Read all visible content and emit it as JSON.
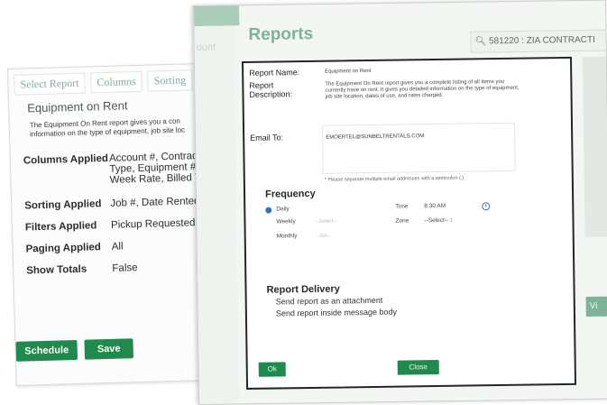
{
  "left_panel": {
    "tabs": [
      "Select Report",
      "Columns",
      "Sorting"
    ],
    "title": "Equipment on Rent",
    "description": [
      "The Equipment On Rent report gives you a con",
      "information on the type of equipment, job site loc"
    ],
    "rows": [
      {
        "key": "Columns Applied",
        "value": [
          "Account #, Contract",
          "Type, Equipment #,",
          "Week Rate, Billed T"
        ]
      },
      {
        "key": "Sorting Applied",
        "value": [
          "Job #, Date Rented,"
        ]
      },
      {
        "key": "Filters Applied",
        "value": [
          "Pickup Requested ="
        ]
      },
      {
        "key": "Paging Applied",
        "value": [
          "All"
        ]
      },
      {
        "key": "Show Totals",
        "value": [
          "False"
        ]
      }
    ],
    "schedule_label": "Schedule",
    "save_label": "Save"
  },
  "right_panel": {
    "sidebar_ghost": "ount",
    "title": "Reports",
    "search_text": "581220 : ZIA CONTRACTI"
  },
  "modal": {
    "report_name_label": "Report Name:",
    "report_name_value": "Equipment on Rent",
    "report_description_label": [
      "Report",
      "Description:"
    ],
    "report_description_value": "The Equipment On Rent report gives you a complete listing of all items you currently have on rent. It gives you detailed information on the type of equipment, job site location, dates of use, and rates charged.",
    "email_to_label": "Email To:",
    "email_to_value": "EMOERTEL@SUNBELTRENTALS.COM",
    "email_note": "* Please separate multiple email addresses with a semicolon (;)",
    "frequency_heading": "Frequency",
    "frequency_options": [
      "Daily",
      "Weekly",
      "Monthly"
    ],
    "frequency_selected": "Daily",
    "weekly_placeholder": "--Select--",
    "monthly_placeholder": "--Sel--",
    "time_label": "Time",
    "time_value": "8:30 AM",
    "zone_label": "Zone",
    "zone_value": "--Select--",
    "delivery_heading": "Report Delivery",
    "delivery_options": [
      "Send report as an attachment",
      "Send report inside message body"
    ],
    "ok_label": "Ok",
    "close_label": "Close"
  },
  "colors": {
    "accent_green": "#1f8a4c",
    "title_green": "#7fb397",
    "radio_blue": "#3a6fbd"
  }
}
